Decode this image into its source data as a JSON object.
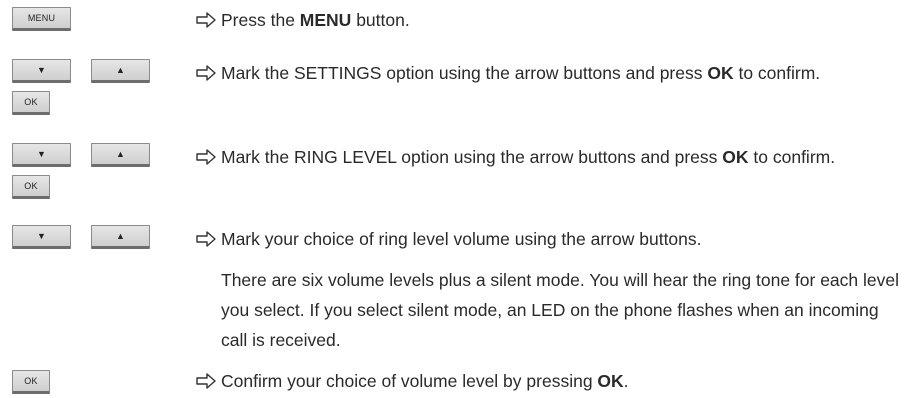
{
  "keys": {
    "menu": "MENU",
    "down": "▼",
    "up": "▲",
    "ok": "OK"
  },
  "steps": [
    {
      "a": "Press the ",
      "b": "MENU",
      "c": " button."
    },
    {
      "a": "Mark the SETTINGS option using the arrow buttons and press ",
      "b": "OK",
      "c": " to confirm."
    },
    {
      "a": "Mark the RING LEVEL option using the arrow buttons and press ",
      "b": "OK",
      "c": " to confirm."
    },
    {
      "a": "Mark your choice of ring level volume using the arrow buttons."
    },
    {
      "a": "Confirm your choice of volume level by pressing ",
      "b": "OK",
      "c": "."
    }
  ],
  "note": "There are six volume levels plus a silent mode. You will hear the ring tone for each level you select. If you select silent mode, an LED on the phone flashes when an incoming call is received."
}
